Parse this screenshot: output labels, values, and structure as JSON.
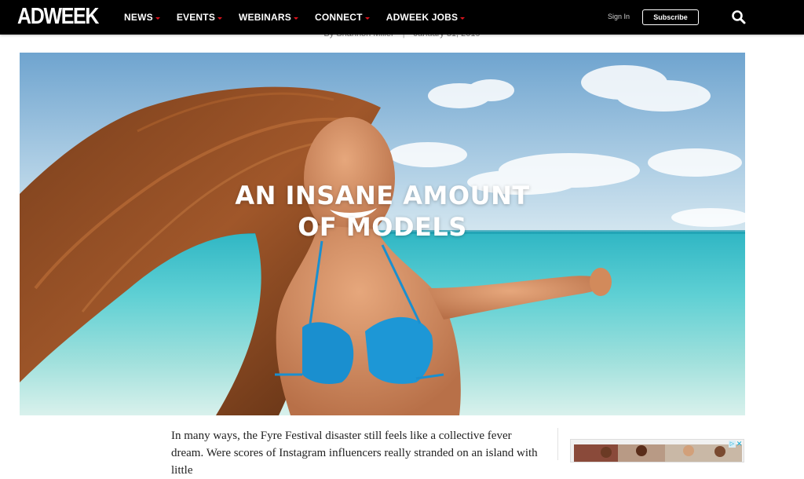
{
  "header": {
    "logo": "ADWEEK",
    "nav": [
      {
        "label": "NEWS"
      },
      {
        "label": "EVENTS"
      },
      {
        "label": "WEBINARS"
      },
      {
        "label": "CONNECT"
      },
      {
        "label": "ADWEEK JOBS"
      }
    ],
    "sign_in": "Sign In",
    "subscribe": "Subscribe",
    "search_icon": "search-icon"
  },
  "article": {
    "author": "By Shannon Miller",
    "separator": "|",
    "date": "January 31, 2019",
    "hero": {
      "title_line1": "AN INSANE AMOUNT",
      "title_line2": "OF MODELS"
    },
    "body": "In many ways, the Fyre Festival disaster still feels like a collective fever dream. Were scores of Instagram influencers really stranded on an island with little"
  },
  "ad": {
    "choices_icon": "ad-choices-icon",
    "close": "✕"
  },
  "colors": {
    "header_bg": "#000000",
    "accent": "#e0141e",
    "text": "#222222"
  }
}
